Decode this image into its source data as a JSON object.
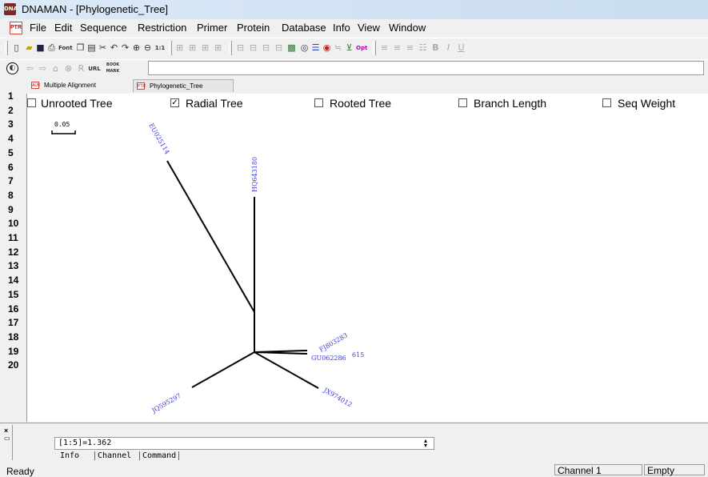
{
  "window": {
    "title": "DNAMAN - [Phylogenetic_Tree]",
    "app_icon": "DNA MAN"
  },
  "menu": {
    "doc_icon": "PTR",
    "items": [
      "File",
      "Edit",
      "Sequence",
      "Restriction",
      "Primer",
      "Protein",
      "Database",
      "Info",
      "View",
      "Window"
    ]
  },
  "toolbar1": {
    "font_label": "Font",
    "zoom_label": "1:1",
    "opt_label": "Opt"
  },
  "toolbar2": {
    "url_label": "URL",
    "book_label": "BOOK MARK",
    "url_value": ""
  },
  "doc_tabs": [
    {
      "label": "Multiple Alignment"
    },
    {
      "label": "Phylogenetic_Tree"
    }
  ],
  "options": {
    "unrooted": {
      "label": "Unrooted Tree",
      "checked": false
    },
    "radial": {
      "label": "Radial Tree",
      "checked": true
    },
    "rooted": {
      "label": "Rooted Tree",
      "checked": false
    },
    "branch_length": {
      "label": "Branch Length",
      "checked": false
    },
    "seq_weight": {
      "label": "Seq Weight",
      "checked": false
    },
    "check_mark": "✓"
  },
  "row_numbers": [
    "1",
    "2",
    "3",
    "4",
    "5",
    "6",
    "7",
    "8",
    "9",
    "10",
    "11",
    "12",
    "13",
    "14",
    "15",
    "16",
    "17",
    "18",
    "19",
    "20"
  ],
  "tree": {
    "scale_label": "0.05",
    "leaves": [
      "EU025114",
      "HQ643180",
      "FJ803283",
      "GU062286",
      "615",
      "JX974012",
      "JQ595297"
    ],
    "color_leaf": "#3a3adb"
  },
  "info": {
    "value": "[1:5]=1.362",
    "tabs": [
      "Info",
      "Channel",
      "Command"
    ]
  },
  "status": {
    "ready": "Ready",
    "channel": "Channel 1",
    "state": "Empty"
  }
}
